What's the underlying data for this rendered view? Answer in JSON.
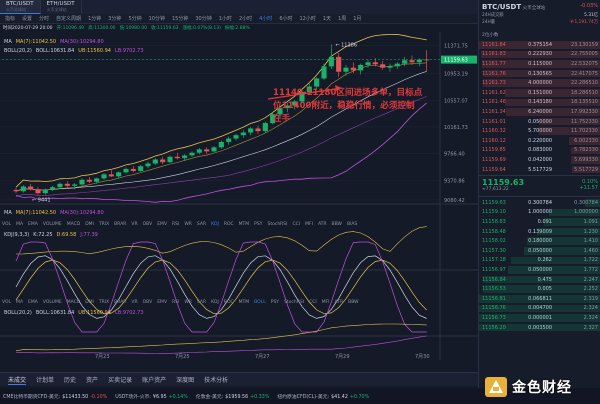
{
  "tabs": [
    {
      "pair": "BTC/USDT",
      "sub": "火币全球站"
    },
    {
      "pair": "ETH/USDT",
      "sub": "火币全球站"
    }
  ],
  "timeframes": [
    "指标",
    "设置",
    "分时",
    "自定义周期",
    "1分钟",
    "3分钟",
    "5分钟",
    "10分钟",
    "15分钟",
    "30分钟",
    "1小时",
    "2小时",
    "4小时",
    "6小时",
    "12小时",
    "1天",
    "1周",
    "1月"
  ],
  "timeframe_selected": "4小时",
  "infobar": {
    "time": "时间2020-07-29 20:00",
    "open": "开:11096.49",
    "high": "高:11300.00",
    "low": "低:10980.00",
    "close": "收:11159.63",
    "change": "涨幅:0.07%(8.13)",
    "amp": "振幅:2.88%"
  },
  "main_legend": {
    "ma_label": "MA",
    "ma7": "MA(7):11042.50",
    "ma30": "MA(30):10294.80",
    "boll_label": "BOLL(20,2)",
    "boll": "BOLL:10631.84",
    "ub": "UB:11560.94",
    "lb": "LB:9702.73"
  },
  "annotation": "11140-11180区间进场多单，目标点位11400附近，稳稳行情，必须控制在手",
  "price_axis": [
    "11371.75",
    "11159.63",
    "10953.19",
    "10557.07",
    "10161.73",
    "9766.40",
    "9370.86",
    "9080.42"
  ],
  "current_price_tag": "11159.63",
  "marks": {
    "high": "11386",
    "low": "9441"
  },
  "vol_legend": {
    "ma_label": "MA",
    "ma7": "MA(7):11042.50",
    "ma30": "MA(30):10294.80"
  },
  "ind_tabs_1": [
    "VOL",
    "MA",
    "EMA",
    "VOLUME",
    "MACD",
    "DMI",
    "TRIX",
    "BRAR",
    "VR",
    "OBV",
    "EMV",
    "RSI",
    "WR",
    "SAR",
    "KDJ",
    "ROC",
    "MTM",
    "PSY",
    "StochRSI",
    "CCI",
    "MFI",
    "ATR",
    "BBW",
    "BIAS"
  ],
  "ind_tabs_2": [
    "VOL",
    "MA",
    "EMA",
    "VOLUME",
    "MACD",
    "DMI",
    "TRIX",
    "BRAR",
    "VR",
    "OBV",
    "EMV",
    "RSI",
    "WR",
    "SAR",
    "KDJ",
    "ROC",
    "MTM",
    "BOLL",
    "PSY",
    "StochRSI",
    "CCI",
    "MFI",
    "ATR",
    "BBW"
  ],
  "kdj_legend": {
    "label": "KDJ(9,3,3)",
    "k": "K:72.25",
    "d": "D:69.58",
    "j": "J:77.39"
  },
  "boll2_legend": {
    "label": "BOLL(20,2)",
    "boll": "BOLL:10631.84",
    "ub": "UB:11560.94",
    "lb": "LB:9702.73"
  },
  "date_axis": [
    "7月23",
    "7月25",
    "7月27",
    "7月29",
    "7月30"
  ],
  "bottom_tabs": [
    "未成交",
    "计划单",
    "历史",
    "资产",
    "买卖记录",
    "账户资产",
    "深度图",
    "技术分析"
  ],
  "ticker": [
    {
      "name": "CME比特币期货CFD-美元:",
      "val": "$11433.50",
      "chg": "-0.10%",
      "up": false
    },
    {
      "name": "USDT场外-火币:",
      "val": "¥6.95",
      "chg": "+0.14%",
      "up": true
    },
    {
      "name": "伦敦金-美元:",
      "val": "$1959.56",
      "chg": "+0.33%",
      "up": true
    },
    {
      "name": "纽约原油CFD(CL)-美元:",
      "val": "$41.42",
      "chg": "+0.70%",
      "up": true
    }
  ],
  "right": {
    "pair": "BTC/USDT",
    "exchange": "火币全球站",
    "stats": [
      {
        "k": "24H成交额",
        "v": "5.31亿"
      },
      {
        "k": "24H量",
        "v": "¥:1,191.74万"
      }
    ],
    "change_pct": "-0.03%",
    "change_rmb": "¥",
    "depth_label": "2位小数",
    "col_price": "价格",
    "col_amt": "数量",
    "col_sum": "累计",
    "asks": [
      {
        "p": "11161.84",
        "a": "0.375154",
        "s": "23.130159"
      },
      {
        "p": "11161.83",
        "a": "0.222930",
        "s": "22.755005"
      },
      {
        "p": "11161.77",
        "a": "0.115000",
        "s": "22.532075"
      },
      {
        "p": "11161.76",
        "a": "0.130565",
        "s": "22.417075"
      },
      {
        "p": "11161.73",
        "a": "4.000000",
        "s": "22.286510"
      },
      {
        "p": "11161.62",
        "a": "0.151000",
        "s": "18.286510"
      },
      {
        "p": "11161.46",
        "a": "0.143180",
        "s": "18.135510"
      },
      {
        "p": "11161.34",
        "a": "6.240000",
        "s": "17.992330"
      },
      {
        "p": "11161.01",
        "a": "0.050000",
        "s": "11.752330"
      },
      {
        "p": "11160.32",
        "a": "5.700000",
        "s": "11.702330"
      },
      {
        "p": "11160.12",
        "a": "0.220000",
        "s": "6.002330"
      },
      {
        "p": "11159.85",
        "a": "0.083000",
        "s": "5.782330"
      },
      {
        "p": "11159.69",
        "a": "0.042000",
        "s": "5.699330"
      },
      {
        "p": "11159.64",
        "a": "5.517729",
        "s": "5.517729"
      }
    ],
    "last_price": "11159.63",
    "last_rmb": "≈77,613.22",
    "last_pct": "0.10%",
    "last_chg": "+11.57",
    "bids": [
      {
        "p": "11159.63",
        "a": "0.300784",
        "s": "0.300784"
      },
      {
        "p": "11159.10",
        "a": "1.000000",
        "s": "1.000000"
      },
      {
        "p": "11158.83",
        "a": "0.091",
        "s": "1.091"
      },
      {
        "p": "11158.48",
        "a": "0.139009",
        "s": "1.230"
      },
      {
        "p": "11158.02",
        "a": "0.180000",
        "s": "1.410"
      },
      {
        "p": "11157.30",
        "a": "0.050000",
        "s": "1.460"
      },
      {
        "p": "11157.18",
        "a": "0.262",
        "s": "1.722"
      },
      {
        "p": "11156.97",
        "a": "0.050000",
        "s": "1.772"
      },
      {
        "p": "11156.84",
        "a": "0.475",
        "s": "2.247"
      },
      {
        "p": "11156.53",
        "a": "0.005",
        "s": "2.252"
      },
      {
        "p": "11156.81",
        "a": "0.066811",
        "s": "2.319"
      },
      {
        "p": "11156.76",
        "a": "0.004700",
        "s": "2.324"
      },
      {
        "p": "11156.73",
        "a": "0.000001",
        "s": "2.324"
      },
      {
        "p": "11156.20",
        "a": "0.003500",
        "s": "2.327"
      }
    ]
  },
  "watermark": "金色财经",
  "candles": [
    [
      9230,
      9260,
      9180,
      9210
    ],
    [
      9210,
      9300,
      9190,
      9280
    ],
    [
      9280,
      9320,
      9220,
      9240
    ],
    [
      9240,
      9270,
      9150,
      9180
    ],
    [
      9180,
      9250,
      9160,
      9230
    ],
    [
      9230,
      9290,
      9210,
      9270
    ],
    [
      9270,
      9340,
      9250,
      9320
    ],
    [
      9320,
      9360,
      9260,
      9290
    ],
    [
      9290,
      9330,
      9240,
      9310
    ],
    [
      9310,
      9400,
      9290,
      9380
    ],
    [
      9380,
      9420,
      9330,
      9350
    ],
    [
      9350,
      9410,
      9320,
      9400
    ],
    [
      9400,
      9480,
      9380,
      9460
    ],
    [
      9460,
      9520,
      9420,
      9430
    ],
    [
      9430,
      9500,
      9410,
      9490
    ],
    [
      9490,
      9560,
      9470,
      9540
    ],
    [
      9540,
      9580,
      9490,
      9510
    ],
    [
      9510,
      9600,
      9500,
      9580
    ],
    [
      9580,
      9650,
      9550,
      9620
    ],
    [
      9620,
      9700,
      9600,
      9680
    ],
    [
      9680,
      9720,
      9610,
      9640
    ],
    [
      9640,
      9740,
      9630,
      9720
    ],
    [
      9720,
      9780,
      9680,
      9700
    ],
    [
      9700,
      9760,
      9660,
      9740
    ],
    [
      9740,
      9800,
      9720,
      9780
    ],
    [
      9780,
      9850,
      9760,
      9830
    ],
    [
      9830,
      9860,
      9760,
      9800
    ],
    [
      9800,
      9880,
      9790,
      9860
    ],
    [
      9860,
      9960,
      9840,
      9940
    ],
    [
      9940,
      10020,
      9900,
      9990
    ],
    [
      9990,
      10060,
      9960,
      10040
    ],
    [
      10040,
      10120,
      10000,
      10080
    ],
    [
      10080,
      10160,
      10040,
      10140
    ],
    [
      10140,
      10180,
      10060,
      10100
    ],
    [
      10100,
      10240,
      10080,
      10220
    ],
    [
      10220,
      10380,
      10200,
      10350
    ],
    [
      10350,
      10480,
      10300,
      10440
    ],
    [
      10440,
      10520,
      10380,
      10480
    ],
    [
      10480,
      10560,
      10420,
      10540
    ],
    [
      10540,
      10700,
      10520,
      10680
    ],
    [
      10680,
      10800,
      10640,
      10760
    ],
    [
      10760,
      10900,
      10720,
      10880
    ],
    [
      10880,
      11100,
      10860,
      11060
    ],
    [
      11060,
      11386,
      11020,
      11200
    ],
    [
      11200,
      11260,
      10900,
      10980
    ],
    [
      10980,
      11080,
      10920,
      11040
    ],
    [
      11040,
      11120,
      10960,
      11000
    ],
    [
      11000,
      11100,
      10940,
      11080
    ],
    [
      11080,
      11160,
      11040,
      11120
    ],
    [
      11120,
      11180,
      11060,
      11090
    ],
    [
      11090,
      11140,
      11010,
      11040
    ],
    [
      11040,
      11100,
      10980,
      11060
    ],
    [
      11060,
      11120,
      11020,
      11100
    ],
    [
      11100,
      11200,
      11060,
      11150
    ],
    [
      11150,
      11220,
      11080,
      11120
    ],
    [
      11120,
      11180,
      11060,
      11160
    ],
    [
      11160,
      11300,
      10980,
      11159
    ]
  ]
}
